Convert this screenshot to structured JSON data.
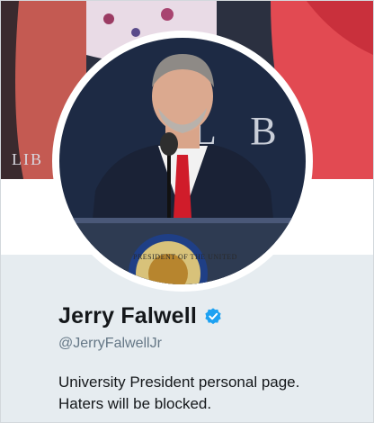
{
  "profile": {
    "display_name": "Jerry Falwell",
    "handle": "@JerryFalwellJr",
    "bio": "University President personal page. Haters will be blocked.",
    "verified": true
  },
  "banner": {
    "sign_text": "LIB",
    "backdrop_letters": "L B R",
    "seal_text": "PRESIDENT OF THE UNITED"
  },
  "colors": {
    "profile_background": "#e6ecf0",
    "verified_badge": "#1da1f2",
    "handle_text": "#657786",
    "name_text": "#14171a"
  },
  "icons": {
    "verified": "verified-badge-icon"
  }
}
